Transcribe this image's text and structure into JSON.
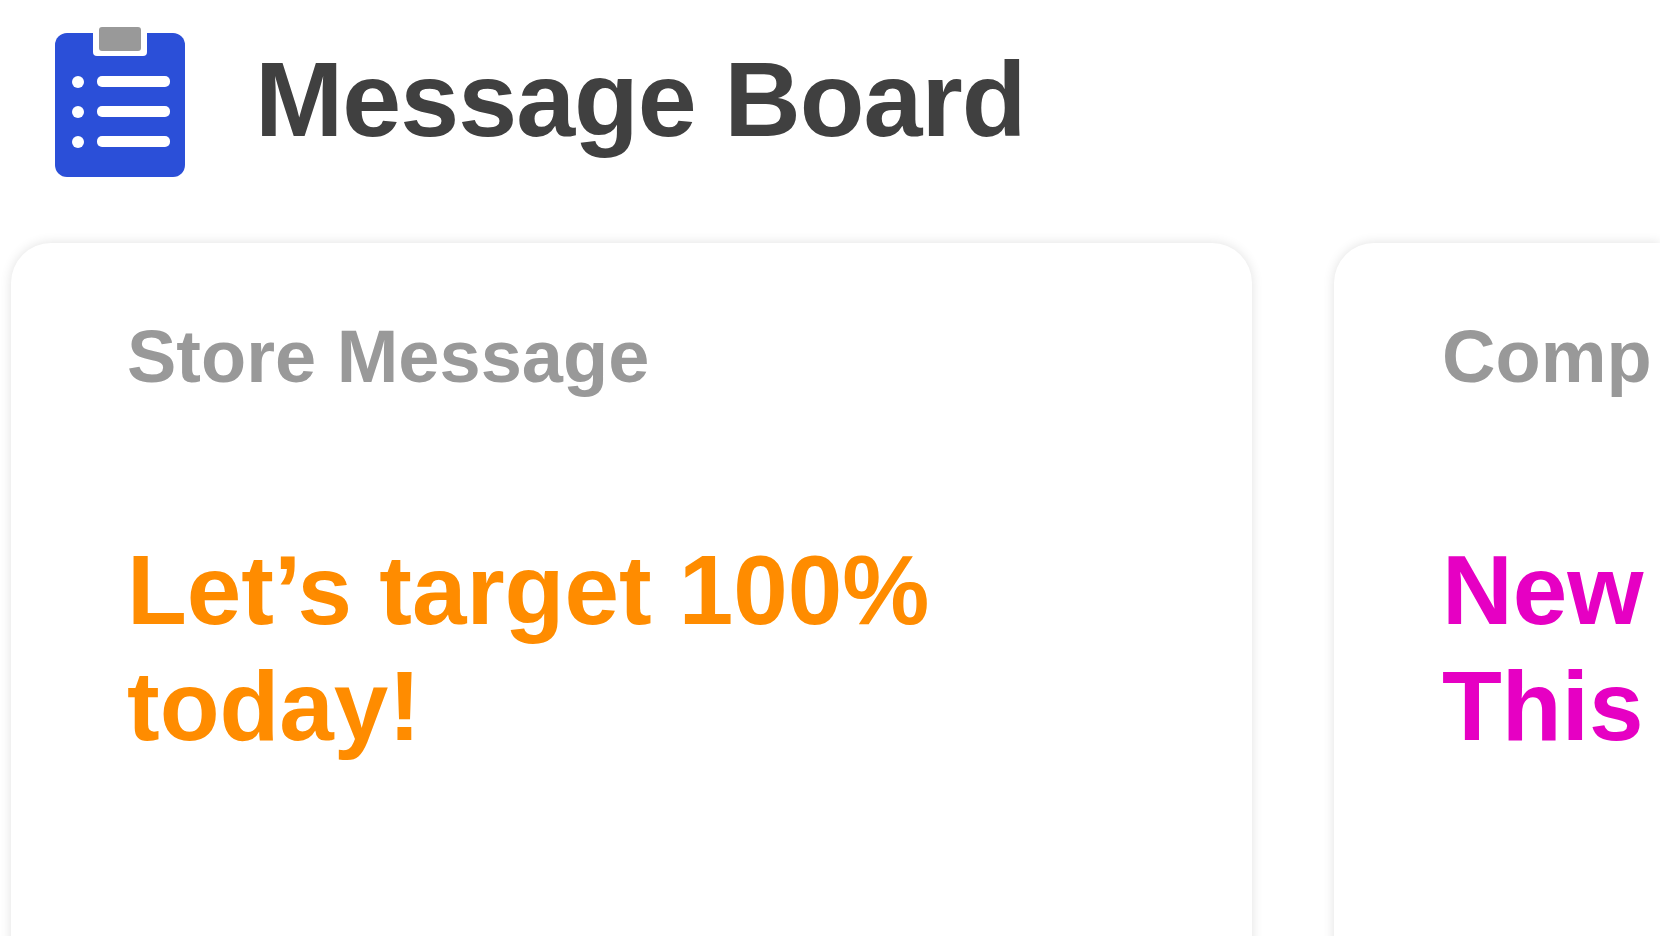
{
  "header": {
    "title": "Message Board"
  },
  "cards": [
    {
      "title": "Store Message",
      "message": "Let’s target 100% today!",
      "color": "#ff8c00"
    },
    {
      "title": "Comp",
      "message": "New This",
      "color": "#e600c3"
    }
  ]
}
